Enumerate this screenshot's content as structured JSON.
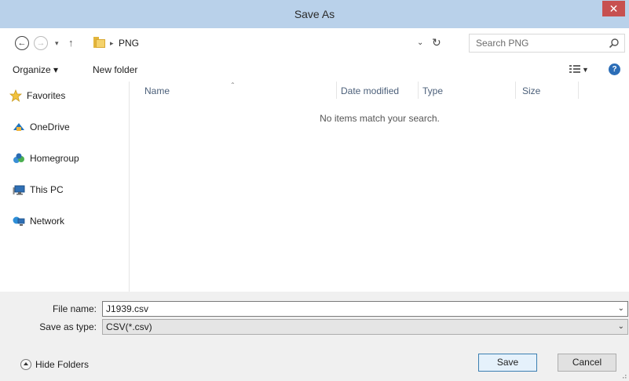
{
  "window": {
    "title": "Save As",
    "close_glyph": "✕"
  },
  "address_bar": {
    "back_glyph": "←",
    "forward_glyph": "→",
    "recent_glyph": "▾",
    "up_glyph": "↑",
    "breadcrumb_sep": "▸",
    "breadcrumb": [
      "PNG"
    ],
    "dropdown_glyph": "⌄",
    "refresh_glyph": "↻",
    "search_placeholder": "Search PNG"
  },
  "toolbar": {
    "organize_label": "Organize ▾",
    "new_folder_label": "New folder",
    "view_drop_glyph": "▼",
    "help_glyph": "?"
  },
  "nav_pane": {
    "items": [
      {
        "label": "Favorites",
        "icon": "star-icon"
      },
      {
        "label": "OneDrive",
        "icon": "onedrive-icon"
      },
      {
        "label": "Homegroup",
        "icon": "homegroup-icon"
      },
      {
        "label": "This PC",
        "icon": "computer-icon"
      },
      {
        "label": "Network",
        "icon": "network-icon"
      }
    ]
  },
  "file_list": {
    "sort_glyph": "⌃",
    "columns": [
      "Name",
      "Date modified",
      "Type",
      "Size"
    ],
    "empty_message": "No items match your search."
  },
  "save_form": {
    "file_name_label": "File name:",
    "file_name_value": "J1939.csv",
    "save_type_label": "Save as type:",
    "save_type_value": "CSV(*.csv)",
    "combo_glyph": "⌄"
  },
  "footer": {
    "hide_folders_label": "Hide Folders",
    "save_label": "Save",
    "cancel_label": "Cancel"
  },
  "colors": {
    "titlebar": "#b9d1ea",
    "close": "#c75050",
    "primary_button_border": "#3c7fb1",
    "footer_bg": "#f0f0f0"
  }
}
